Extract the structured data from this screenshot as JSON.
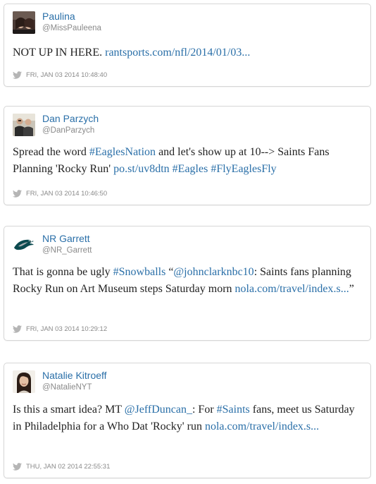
{
  "tweets": [
    {
      "name": "Paulina",
      "handle": "@MissPauleena",
      "text": "NOT UP IN HERE.",
      "link": "rantsports.com/nfl/2014/01/03...",
      "timestamp": "FRI, JAN 03 2014 10:48:40",
      "avatar_icon": "user-photo"
    },
    {
      "name": "Dan Parzych",
      "handle": "@DanParzych",
      "text_part1": "Spread the word",
      "hashtag1": "#EaglesNation",
      "text_part2": "and let's show up at 10--> Saints Fans Planning 'Rocky Run'",
      "link": "po.st/uv8dtn",
      "hashtag2": "#Eagles",
      "hashtag3": "#FlyEaglesFly",
      "timestamp": "FRI, JAN 03 2014 10:46:50",
      "avatar_icon": "user-photo"
    },
    {
      "name": "NR Garrett",
      "handle": "@NR_Garrett",
      "text_part1": "That is gonna be ugly",
      "hashtag1": "#Snowballs",
      "quote_open": "“",
      "mention": "@johnclarknbc10",
      "text_part2": ": Saints fans planning Rocky Run on Art Museum steps Saturday morn",
      "link": "nola.com/travel/index.s...",
      "quote_close": "”",
      "timestamp": "FRI, JAN 03 2014 10:29:12",
      "avatar_icon": "eagles-logo"
    },
    {
      "name": "Natalie Kitroeff",
      "handle": "@NatalieNYT",
      "text_part1": "Is this a smart idea? MT",
      "mention": "@JeffDuncan_",
      "text_part2": ": For",
      "hashtag1": "#Saints",
      "text_part3": "fans, meet us Saturday in Philadelphia for a Who Dat 'Rocky' run",
      "link": "nola.com/travel/index.s...",
      "timestamp": "THU, JAN 02 2014 22:55:31",
      "avatar_icon": "user-photo"
    }
  ],
  "colors": {
    "link": "#2a6fa8",
    "meta": "#8a8a8a",
    "border": "#d6d6d6"
  },
  "icons": {
    "timestamp_icon": "twitter-bird-icon"
  }
}
